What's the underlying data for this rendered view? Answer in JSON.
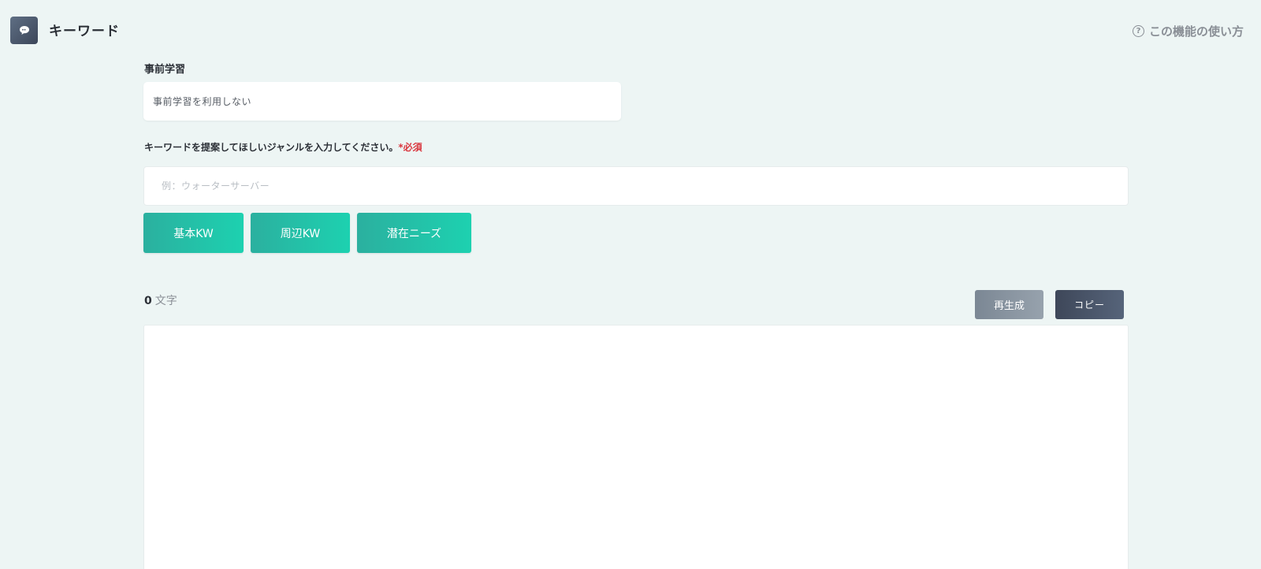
{
  "header": {
    "title": "キーワード",
    "help_label": "この機能の使い方",
    "help_icon": "?"
  },
  "prelearning": {
    "label": "事前学習",
    "selected": "事前学習を利用しない"
  },
  "genre": {
    "label": "キーワードを提案してほしいジャンルを入力してください。",
    "required_mark": "*必須",
    "value": "",
    "placeholder": "例：ウォーターサーバー"
  },
  "kw_buttons": [
    {
      "label": "基本KW"
    },
    {
      "label": "周辺KW"
    },
    {
      "label": "潜在ニーズ"
    }
  ],
  "result": {
    "char_count": "0",
    "char_unit": "文字",
    "regenerate_label": "再生成",
    "copy_label": "コピー",
    "content": ""
  },
  "colors": {
    "background": "#edf5f4",
    "accent_start": "#2bb09f",
    "accent_end": "#1dd1b0",
    "required": "#d9363e",
    "copy_button": "#3e4759",
    "regen_button": "#7b8794"
  }
}
